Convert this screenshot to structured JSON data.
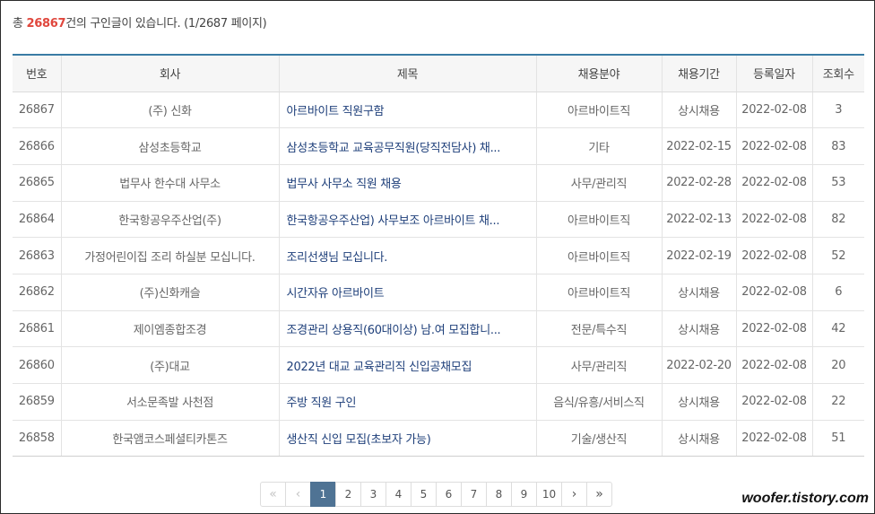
{
  "summary": {
    "prefix": "총 ",
    "count": "26867",
    "suffix": "건의 구인글이 있습니다. (1/2687 페이지)"
  },
  "table": {
    "headers": [
      "번호",
      "회사",
      "제목",
      "채용분야",
      "채용기간",
      "등록일자",
      "조회수"
    ],
    "rows": [
      {
        "no": "26867",
        "company": "(주) 신화",
        "title": "아르바이트 직원구함",
        "field": "아르바이트직",
        "period": "상시채용",
        "date": "2022-02-08",
        "views": "3"
      },
      {
        "no": "26866",
        "company": "삼성초등학교",
        "title": "삼성초등학교 교육공무직원(당직전담사) 채...",
        "field": "기타",
        "period": "2022-02-15",
        "date": "2022-02-08",
        "views": "83"
      },
      {
        "no": "26865",
        "company": "법무사 한수대 사무소",
        "title": "법무사 사무소 직원 채용",
        "field": "사무/관리직",
        "period": "2022-02-28",
        "date": "2022-02-08",
        "views": "53"
      },
      {
        "no": "26864",
        "company": "한국항공우주산업(주)",
        "title": "한국항공우주산업) 사무보조 아르바이트 채...",
        "field": "아르바이트직",
        "period": "2022-02-13",
        "date": "2022-02-08",
        "views": "82"
      },
      {
        "no": "26863",
        "company": "가정어린이집 조리 하실분 모십니다.",
        "title": "조리선생님 모십니다.",
        "field": "아르바이트직",
        "period": "2022-02-19",
        "date": "2022-02-08",
        "views": "52"
      },
      {
        "no": "26862",
        "company": "(주)신화캐슬",
        "title": "시간자유 아르바이트",
        "field": "아르바이트직",
        "period": "상시채용",
        "date": "2022-02-08",
        "views": "6"
      },
      {
        "no": "26861",
        "company": "제이엠종합조경",
        "title": "조경관리 상용직(60대이상) 남.여 모집합니...",
        "field": "전문/특수직",
        "period": "상시채용",
        "date": "2022-02-08",
        "views": "42"
      },
      {
        "no": "26860",
        "company": "(주)대교",
        "title": "2022년 대교 교육관리직 신입공채모집",
        "field": "사무/관리직",
        "period": "2022-02-20",
        "date": "2022-02-08",
        "views": "20"
      },
      {
        "no": "26859",
        "company": "서소문족발 사천점",
        "title": "주방 직원 구인",
        "field": "음식/유흥/서비스직",
        "period": "상시채용",
        "date": "2022-02-08",
        "views": "22"
      },
      {
        "no": "26858",
        "company": "한국앰코스페셜티카톤즈",
        "title": "생산직 신입 모집(초보자 가능)",
        "field": "기술/생산직",
        "period": "상시채용",
        "date": "2022-02-08",
        "views": "51"
      }
    ]
  },
  "pagination": {
    "first": "«",
    "prev": "‹",
    "pages": [
      "1",
      "2",
      "3",
      "4",
      "5",
      "6",
      "7",
      "8",
      "9",
      "10"
    ],
    "current": "1",
    "next": "›",
    "last": "»"
  },
  "watermark": "woofer.tistory.com",
  "colors": {
    "count_highlight": "#e0473d",
    "title_link": "#1e3f7a",
    "header_top_border": "#3a7ca5",
    "active_page": "#4f7394"
  }
}
